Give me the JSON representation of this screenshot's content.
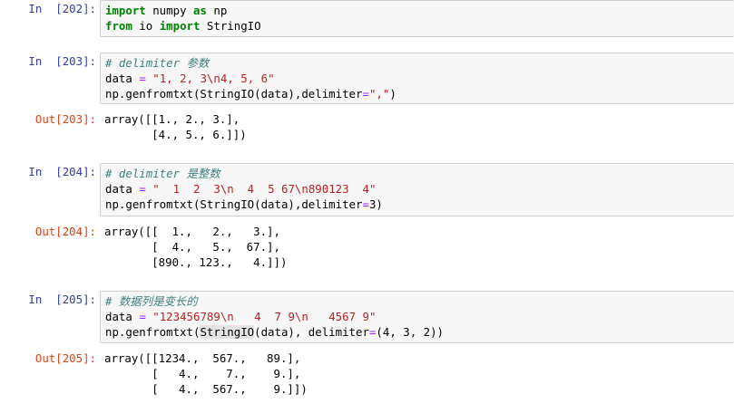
{
  "cells": [
    {
      "in_prompt": "In  [202]:",
      "lines": [
        [
          {
            "t": "import",
            "c": "kw"
          },
          {
            "t": " numpy "
          },
          {
            "t": "as",
            "c": "kw"
          },
          {
            "t": " np"
          }
        ],
        [
          {
            "t": "from",
            "c": "kw"
          },
          {
            "t": " io "
          },
          {
            "t": "import",
            "c": "kw"
          },
          {
            "t": " StringIO"
          }
        ]
      ]
    },
    {
      "in_prompt": "In  [203]:",
      "lines": [
        [
          {
            "t": "# delimiter 参数",
            "c": "cm"
          }
        ],
        [
          {
            "t": "data "
          },
          {
            "t": "=",
            "c": "op"
          },
          {
            "t": " "
          },
          {
            "t": "\"1, 2, 3\\n4, 5, 6\"",
            "c": "st"
          }
        ],
        [
          {
            "t": "np.genfromtxt(StringIO(data),delimiter"
          },
          {
            "t": "=",
            "c": "op"
          },
          {
            "t": "\",\"",
            "c": "st"
          },
          {
            "t": ")"
          }
        ]
      ],
      "out_prompt": "Out[203]:",
      "output": [
        "array([[1., 2., 3.],",
        "       [4., 5., 6.]])"
      ]
    },
    {
      "in_prompt": "In  [204]:",
      "lines": [
        [
          {
            "t": "# delimiter 是整数",
            "c": "cm"
          }
        ],
        [
          {
            "t": "data "
          },
          {
            "t": "=",
            "c": "op"
          },
          {
            "t": " "
          },
          {
            "t": "\"  1  2  3\\n  4  5 67\\n890123  4\"",
            "c": "st"
          }
        ],
        [
          {
            "t": "np.genfromtxt(StringIO(data),delimiter"
          },
          {
            "t": "=",
            "c": "op"
          },
          {
            "t": "3)"
          }
        ]
      ],
      "out_prompt": "Out[204]:",
      "output": [
        "array([[  1.,   2.,   3.],",
        "       [  4.,   5.,  67.],",
        "       [890., 123.,   4.]])"
      ]
    },
    {
      "in_prompt": "In  [205]:",
      "lines": [
        [
          {
            "t": "# 数据列是变长的",
            "c": "cm"
          }
        ],
        [
          {
            "t": "data "
          },
          {
            "t": "=",
            "c": "op"
          },
          {
            "t": " "
          },
          {
            "t": "\"123456789\\n   4  7 9\\n   4567 9\"",
            "c": "st"
          }
        ],
        [
          {
            "t": "np.genfromtxt("
          },
          {
            "t": "StringIO",
            "c": "hl"
          },
          {
            "t": "(data), delimiter"
          },
          {
            "t": "=",
            "c": "op"
          },
          {
            "t": "(4, 3, 2))"
          }
        ]
      ],
      "out_prompt": "Out[205]:",
      "output": [
        "array([[1234.,  567.,   89.],",
        "       [   4.,    7.,    9.],",
        "       [   4.,  567.,    9.]])"
      ]
    }
  ]
}
